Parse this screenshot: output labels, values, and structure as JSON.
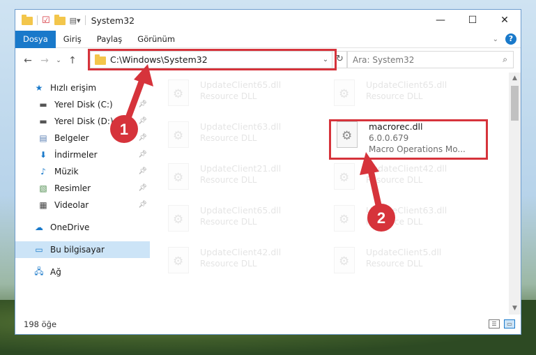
{
  "window": {
    "title": "System32",
    "controls": {
      "minimize": "—",
      "maximize": "☐",
      "close": "✕"
    }
  },
  "ribbon": {
    "tabs": [
      "Dosya",
      "Giriş",
      "Paylaş",
      "Görünüm"
    ],
    "active_tab": "Dosya"
  },
  "address": {
    "path": "C:\\Windows\\System32",
    "search_placeholder": "Ara: System32"
  },
  "sidebar": {
    "quick_access_label": "Hızlı erişim",
    "items": [
      {
        "label": "Yerel Disk (C:)",
        "icon": "drive-icon",
        "pinned": true
      },
      {
        "label": "Yerel Disk (D:)",
        "icon": "drive-icon",
        "pinned": true
      },
      {
        "label": "Belgeler",
        "icon": "documents-icon",
        "pinned": true
      },
      {
        "label": "İndirmeler",
        "icon": "downloads-icon",
        "pinned": true
      },
      {
        "label": "Müzik",
        "icon": "music-icon",
        "pinned": true
      },
      {
        "label": "Resimler",
        "icon": "pictures-icon",
        "pinned": true
      },
      {
        "label": "Videolar",
        "icon": "videos-icon",
        "pinned": true
      }
    ],
    "onedrive": "OneDrive",
    "this_pc": "Bu bilgisayar",
    "network": "Ağ"
  },
  "files": {
    "left_column": [
      {
        "name": "UpdateClient65.dll",
        "desc": "Resource DLL"
      },
      {
        "name": "UpdateClient63.dll",
        "desc": "Resource DLL"
      },
      {
        "name": "UpdateClient21.dll",
        "desc": "Resource DLL"
      },
      {
        "name": "UpdateClient65.dll",
        "desc": "Resource DLL"
      },
      {
        "name": "UpdateClient42.dll",
        "desc": "Resource DLL"
      }
    ],
    "right_column": [
      {
        "name": "UpdateClient65.dll",
        "desc": "Resource DLL"
      },
      {
        "name": "macrorec.dll",
        "version": "6.0.0.679",
        "desc": "Macro Operations Mo...",
        "highlighted": true
      },
      {
        "name": "UpdateClient42.dll",
        "desc": "Resource DLL"
      },
      {
        "name": "UpdateClient63.dll",
        "desc": "Resource DLL"
      },
      {
        "name": "UpdateClient5.dll",
        "desc": "Resource DLL"
      }
    ]
  },
  "annotations": {
    "step1": "1",
    "step2": "2",
    "color": "#d6333b"
  },
  "status": {
    "item_count": "198 öğe"
  }
}
